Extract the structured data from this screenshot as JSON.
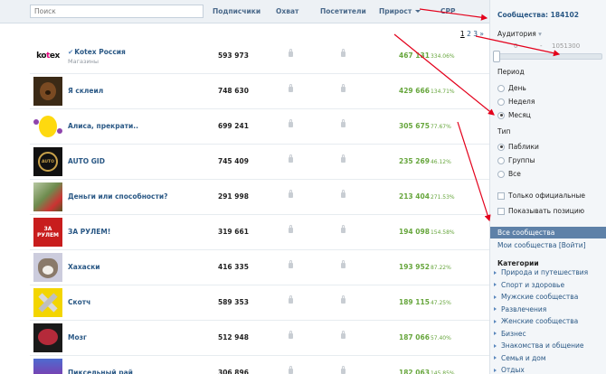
{
  "header": {
    "search_placeholder": "Поиск",
    "columns": [
      "Подписчики",
      "Охват",
      "Посетители",
      "Прирост",
      "CPP"
    ]
  },
  "pager": {
    "current": "1",
    "pages": [
      "2",
      "3"
    ],
    "next": "»"
  },
  "rows": [
    {
      "name": "Kotex Россия",
      "sub": "Магазины",
      "verified": true,
      "subscribers": "593 973",
      "growth": "467 131",
      "growth_pct": "334.06%",
      "avatar": "kotex-logo"
    },
    {
      "name": "Я склеил",
      "sub": "",
      "verified": false,
      "subscribers": "748 630",
      "growth": "429 666",
      "growth_pct": "134.71%",
      "avatar": "bear-icon"
    },
    {
      "name": "Алиса, прекрати..",
      "sub": "",
      "verified": false,
      "subscribers": "699 241",
      "growth": "305 675",
      "growth_pct": "77.67%",
      "avatar": "cartoon-icon"
    },
    {
      "name": "AUTO GID",
      "sub": "",
      "verified": false,
      "subscribers": "745 409",
      "growth": "235 269",
      "growth_pct": "46.12%",
      "avatar": "auto-gid-logo"
    },
    {
      "name": "Деньги или способности?",
      "sub": "",
      "verified": false,
      "subscribers": "291 998",
      "growth": "213 404",
      "growth_pct": "271.53%",
      "avatar": "money-icon"
    },
    {
      "name": "ЗА РУЛЕМ!",
      "sub": "",
      "verified": false,
      "subscribers": "319 661",
      "growth": "194 098",
      "growth_pct": "154.58%",
      "avatar": "za-rulem-logo"
    },
    {
      "name": "Хахаски",
      "sub": "",
      "verified": false,
      "subscribers": "416 335",
      "growth": "193 952",
      "growth_pct": "87.22%",
      "avatar": "husky-icon"
    },
    {
      "name": "Скотч",
      "sub": "",
      "verified": false,
      "subscribers": "589 353",
      "growth": "189 115",
      "growth_pct": "47.25%",
      "avatar": "cross-icon"
    },
    {
      "name": "Мозг",
      "sub": "",
      "verified": false,
      "subscribers": "512 948",
      "growth": "187 066",
      "growth_pct": "57.40%",
      "avatar": "brain-icon"
    },
    {
      "name": "Пиксельный рай",
      "sub": "",
      "verified": false,
      "subscribers": "306 896",
      "growth": "182 063",
      "growth_pct": "145.85%",
      "avatar": "pixel-icon"
    }
  ],
  "sidebar": {
    "count_label": "Сообщества: 184102",
    "audience_label": "Аудитория",
    "slider_min": "0",
    "slider_sep": "-",
    "slider_max": "1051300",
    "period_label": "Период",
    "periods": [
      "День",
      "Неделя",
      "Месяц"
    ],
    "period_selected": "Месяц",
    "type_label": "Тип",
    "types": [
      "Паблики",
      "Группы",
      "Все"
    ],
    "type_selected": "Паблики",
    "checks": [
      "Только официальные",
      "Показывать позицию"
    ],
    "nav_all": "Все сообщества",
    "nav_mine": "Мои сообщества [Войти]",
    "categories_label": "Категории",
    "categories": [
      "Природа и путешествия",
      "Спорт и здоровье",
      "Мужские сообщества",
      "Развлечения",
      "Женские сообщества",
      "Бизнес",
      "Знакомства и общение",
      "Семья и дом",
      "Отдых"
    ]
  },
  "colors": {
    "link": "#2a5885",
    "growth": "#67a63d",
    "accent": "#5e81a8",
    "arrow": "#e3001b"
  }
}
